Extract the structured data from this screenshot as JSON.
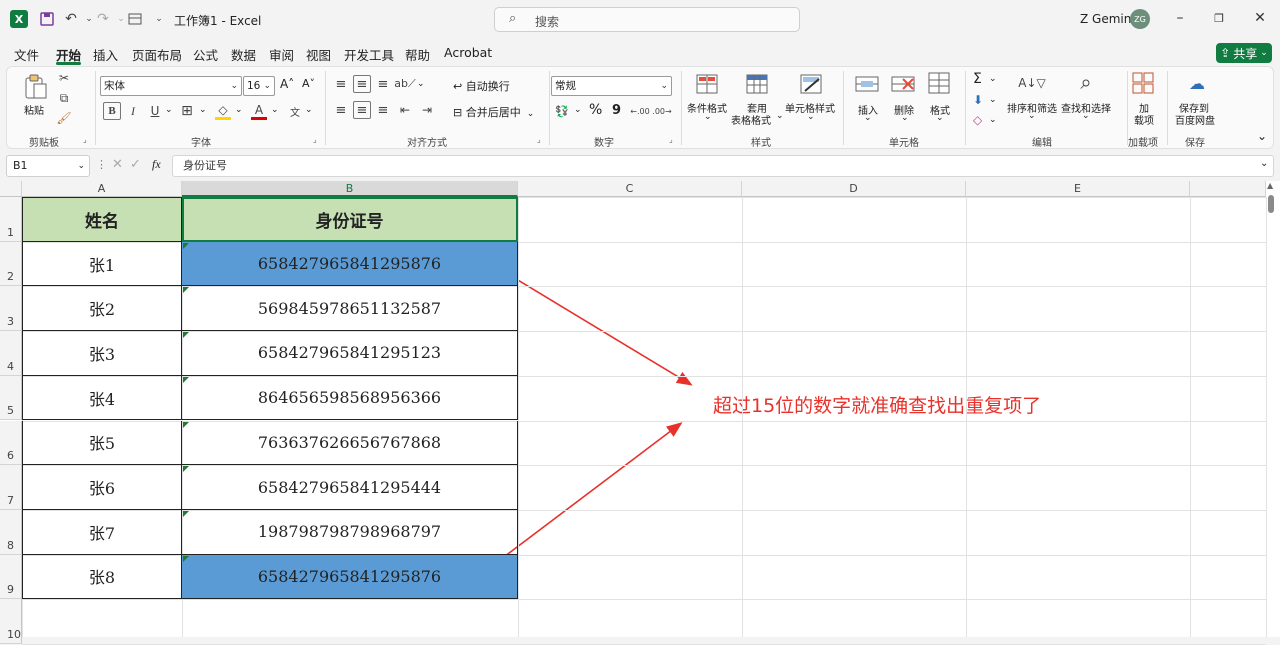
{
  "titlebar": {
    "doc_title": "工作簿1 - Excel",
    "search_placeholder": "搜索",
    "user_name": "Z Gemini",
    "avatar_initials": "ZG",
    "app_logo": "X"
  },
  "menu": {
    "tabs": [
      "文件",
      "开始",
      "插入",
      "页面布局",
      "公式",
      "数据",
      "审阅",
      "视图",
      "开发工具",
      "帮助",
      "Acrobat"
    ],
    "active": "开始",
    "share_label": "共享"
  },
  "ribbon": {
    "clipboard": {
      "paste": "粘贴",
      "group": "剪贴板"
    },
    "font": {
      "font_name": "宋体",
      "font_size": "16",
      "bold": "B",
      "italic": "I",
      "underline": "U",
      "group": "字体"
    },
    "alignment": {
      "wrap": "自动换行",
      "merge": "合并后居中",
      "group": "对齐方式"
    },
    "number": {
      "format": "常规",
      "percent": "%",
      "comma": "9",
      "group": "数字"
    },
    "styles": {
      "conditional": "条件格式",
      "table_line1": "套用",
      "table_line2": "表格格式",
      "cell_styles": "单元格样式",
      "group": "样式"
    },
    "cells": {
      "insert": "插入",
      "delete": "删除",
      "format": "格式",
      "group": "单元格"
    },
    "editing": {
      "sort_filter": "排序和筛选",
      "find_select": "查找和选择",
      "group": "编辑"
    },
    "addins": {
      "line1": "加",
      "line2": "载项",
      "group": "加载项"
    },
    "save": {
      "line1": "保存到",
      "line2": "百度网盘",
      "group": "保存"
    }
  },
  "formula_bar": {
    "name_box": "B1",
    "fx": "fx",
    "content": "身份证号"
  },
  "sheet": {
    "columns": [
      "A",
      "B",
      "C",
      "D",
      "E"
    ],
    "selected_column": "B",
    "row_numbers": [
      "1",
      "2",
      "3",
      "4",
      "5",
      "6",
      "7",
      "8",
      "9",
      "10"
    ],
    "header": {
      "name": "姓名",
      "id": "身份证号"
    },
    "rows": [
      {
        "name": "张1",
        "id": "658427965841295876",
        "highlight": true
      },
      {
        "name": "张2",
        "id": "569845978651132587",
        "highlight": false
      },
      {
        "name": "张3",
        "id": "658427965841295123",
        "highlight": false
      },
      {
        "name": "张4",
        "id": "864656598568956366",
        "highlight": false
      },
      {
        "name": "张5",
        "id": "763637626656767868",
        "highlight": false
      },
      {
        "name": "张6",
        "id": "658427965841295444",
        "highlight": false
      },
      {
        "name": "张7",
        "id": "198798798798968797",
        "highlight": false
      },
      {
        "name": "张8",
        "id": "658427965841295876",
        "highlight": true
      }
    ],
    "highlight_color": "#5b9bd5",
    "header_color": "#c6e0b4"
  },
  "annotation": {
    "text": "超过15位的数字就准确查找出重复项了",
    "color": "#e8312b"
  }
}
